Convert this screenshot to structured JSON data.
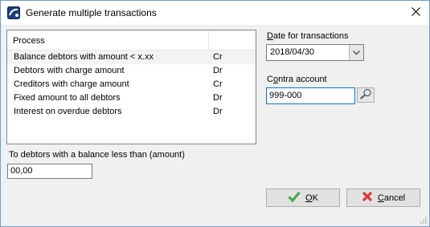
{
  "window": {
    "title": "Generate multiple transactions"
  },
  "process_list": {
    "header": "Process",
    "rows": [
      {
        "name": "Balance debtors with amount < x.xx",
        "type": "Cr"
      },
      {
        "name": "Debtors with charge amount",
        "type": "Dr"
      },
      {
        "name": "Creditors with charge amount",
        "type": "Cr"
      },
      {
        "name": "Fixed amount to all debtors",
        "type": "Dr"
      },
      {
        "name": "Interest on overdue debtors",
        "type": "Dr"
      }
    ]
  },
  "amount": {
    "label": "To debtors with a balance less than (amount)",
    "value": "00,00"
  },
  "date": {
    "label_accel": "D",
    "label_rest": "ate for transactions",
    "value": "2018/04/30"
  },
  "contra": {
    "label_prefix": "C",
    "label_accel": "o",
    "label_rest": "ntra account",
    "value": "999-000"
  },
  "buttons": {
    "ok_accel": "O",
    "ok_rest": "K",
    "cancel_accel": "C",
    "cancel_rest": "ancel"
  },
  "colors": {
    "selected_row": "#f3f3f3",
    "ok_check": "#3fa63f",
    "cancel_x": "#d9383a",
    "focus_border": "#0078d7"
  },
  "icons": [
    "app-icon",
    "close-icon",
    "chevron-down-icon",
    "magnifier-icon",
    "check-icon",
    "cancel-x-icon",
    "resize-grip-icon"
  ]
}
